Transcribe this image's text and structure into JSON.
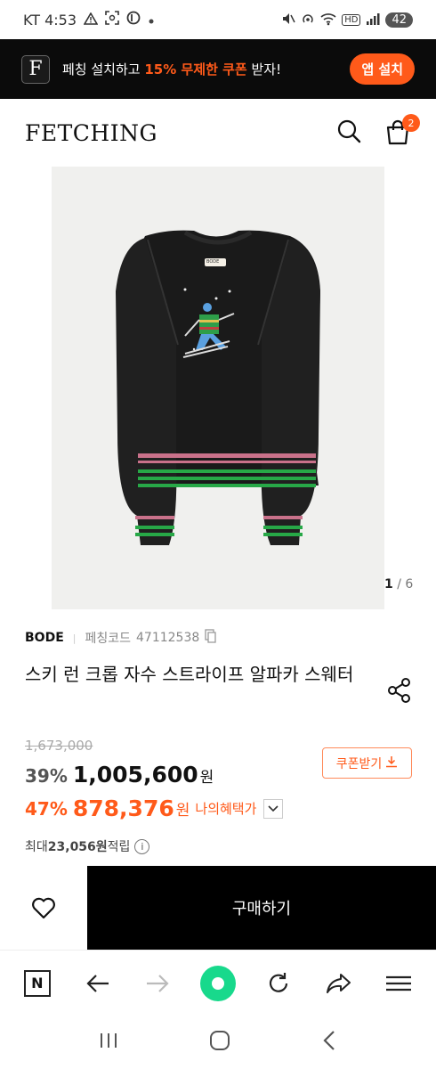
{
  "status_bar": {
    "carrier_time": "KT 4:53",
    "battery": "42",
    "hd_label": "HD"
  },
  "promo": {
    "logo_letter": "F",
    "text_before": "페칭 설치하고 ",
    "text_highlight": "15% 무제한 쿠폰",
    "text_after": " 받자!",
    "button_label": "앱 설치"
  },
  "header": {
    "brand": "FETCHING",
    "cart_count": "2"
  },
  "gallery": {
    "current": "1",
    "separator": " / ",
    "total": "6",
    "sweater_tag": "BODE"
  },
  "product": {
    "brand": "BODE",
    "code_label": "페칭코드",
    "code": "47112538",
    "title": "스키 런 크롭 자수 스트라이프 알파카 스웨터",
    "original_price": "1,673,000",
    "discount": "39%",
    "price": "1,005,600",
    "won": "원",
    "benefit_discount": "47%",
    "benefit_price": "878,376",
    "benefit_label": "나의혜택가",
    "coupon_label": "쿠폰받기",
    "points_prefix": "최대 ",
    "points_value": "23,056원",
    "points_suffix": " 적립"
  },
  "actions": {
    "buy_label": "구매하기"
  },
  "colors": {
    "accent": "#ff5a1a",
    "browser_home": "#18d98c"
  }
}
